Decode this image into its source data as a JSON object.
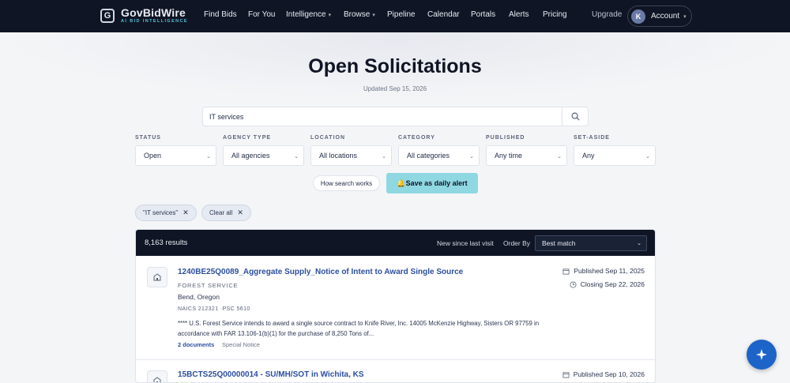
{
  "brand": {
    "name": "GovBidWire",
    "tagline": "AI BID INTELLIGENCE",
    "mark": "G"
  },
  "nav": {
    "items": [
      {
        "label": "Find Bids",
        "dropdown": false
      },
      {
        "label": "For You",
        "dropdown": false
      },
      {
        "label": "Intelligence",
        "dropdown": true
      },
      {
        "label": "Browse",
        "dropdown": true
      },
      {
        "label": "Pipeline",
        "dropdown": false
      },
      {
        "label": "Calendar",
        "dropdown": false
      },
      {
        "label": "Portals",
        "dropdown": false
      },
      {
        "label": "Alerts",
        "dropdown": false
      },
      {
        "label": "Pricing",
        "dropdown": false
      }
    ],
    "upgrade": "Upgrade",
    "account": {
      "initial": "K",
      "label": "Account"
    }
  },
  "page": {
    "title": "Open Solicitations",
    "updated": "Updated Sep 15, 2026"
  },
  "search": {
    "value": "IT services",
    "icon": "search-icon"
  },
  "filters": [
    {
      "label": "STATUS",
      "value": "Open"
    },
    {
      "label": "AGENCY TYPE",
      "value": "All agencies"
    },
    {
      "label": "LOCATION",
      "value": "All locations"
    },
    {
      "label": "CATEGORY",
      "value": "All categories"
    },
    {
      "label": "PUBLISHED",
      "value": "Any time"
    },
    {
      "label": "SET-ASIDE",
      "value": "Any"
    }
  ],
  "actions": {
    "how": "How search works",
    "save_alert": "🔔Save as daily alert"
  },
  "chips": {
    "query": "\"IT services\"",
    "clear": "Clear all"
  },
  "results": {
    "count": "8,163 results",
    "new_since": "New since last visit",
    "order_by": "Order By",
    "sort_value": "Best match",
    "items": [
      {
        "title": "1240BE25Q0089_Aggregate Supply_Notice of Intent to Award Single Source",
        "agency": "FOREST SERVICE",
        "location": "Bend, Oregon",
        "codes": "NAICS 212321 ·PSC 5610",
        "description": "**** U.S. Forest Service intends to award a single source contract to Knife River, Inc. 14005 McKenzie Highway, Sisters OR 97759 in accordance with FAR 13.106-1(b)(1) for the purchase of 8,250 Tons of...",
        "documents": "2 documents",
        "type": "Special Notice",
        "published": "Published Sep 11, 2025",
        "closing": "Closing Sep 22, 2026"
      },
      {
        "title": "15BCTS25Q00000014 - SU/MH/SOT in Wichita, KS",
        "published": "Published Sep 10, 2026"
      }
    ]
  },
  "colors": {
    "nav_bg": "#0f1524",
    "link": "#2c4ea0",
    "alert_btn": "#8fd8e2",
    "fab": "#1d64c8"
  }
}
